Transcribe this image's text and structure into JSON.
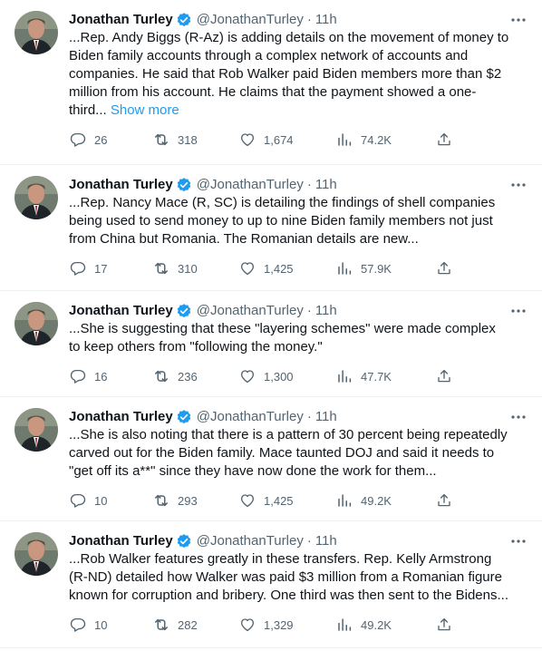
{
  "tweets": [
    {
      "author": "Jonathan Turley",
      "handle": "@JonathanTurley",
      "separator": "·",
      "time": "11h",
      "text": "...Rep. Andy Biggs (R-Az) is adding details on the movement of money to Biden family accounts through a complex network of accounts and companies. He said that Rob Walker paid Biden members more than $2 million from his account. He claims that the payment showed a one-third...",
      "show_more": "Show more",
      "replies": "26",
      "retweets": "318",
      "likes": "1,674",
      "views": "74.2K"
    },
    {
      "author": "Jonathan Turley",
      "handle": "@JonathanTurley",
      "separator": "·",
      "time": "11h",
      "text": "...Rep. Nancy Mace (R, SC) is detailing the findings of shell companies being used to send money to up to nine Biden family members not just from China but Romania.  The Romanian details are new...",
      "show_more": "",
      "replies": "17",
      "retweets": "310",
      "likes": "1,425",
      "views": "57.9K"
    },
    {
      "author": "Jonathan Turley",
      "handle": "@JonathanTurley",
      "separator": "·",
      "time": "11h",
      "text": "...She is suggesting that these \"layering schemes\" were made complex to keep others from \"following the money.\"",
      "show_more": "",
      "replies": "16",
      "retweets": "236",
      "likes": "1,300",
      "views": "47.7K"
    },
    {
      "author": "Jonathan Turley",
      "handle": "@JonathanTurley",
      "separator": "·",
      "time": "11h",
      "text": "...She is also noting that there is a pattern of 30 percent being repeatedly carved out for the Biden family. Mace taunted DOJ and said it needs to \"get off its a**\" since they have now done the work for them...",
      "show_more": "",
      "replies": "10",
      "retweets": "293",
      "likes": "1,425",
      "views": "49.2K"
    },
    {
      "author": "Jonathan Turley",
      "handle": "@JonathanTurley",
      "separator": "·",
      "time": "11h",
      "text": "...Rob Walker features greatly in these transfers. Rep. Kelly Armstrong (R-ND) detailed how Walker was paid $3 million from a Romanian figure known for corruption and bribery. One third was then sent to the Bidens...",
      "show_more": "",
      "replies": "10",
      "retweets": "282",
      "likes": "1,329",
      "views": "49.2K"
    }
  ],
  "icons": {
    "verified": "verified-badge-icon",
    "more": "more-icon",
    "reply": "reply-icon",
    "retweet": "retweet-icon",
    "like": "like-icon",
    "views": "views-icon",
    "share": "share-icon"
  },
  "colors": {
    "text": "#0f1419",
    "secondary": "#536471",
    "link": "#1d9bf0",
    "verified": "#1d9bf0",
    "divider": "#eff3f4"
  }
}
